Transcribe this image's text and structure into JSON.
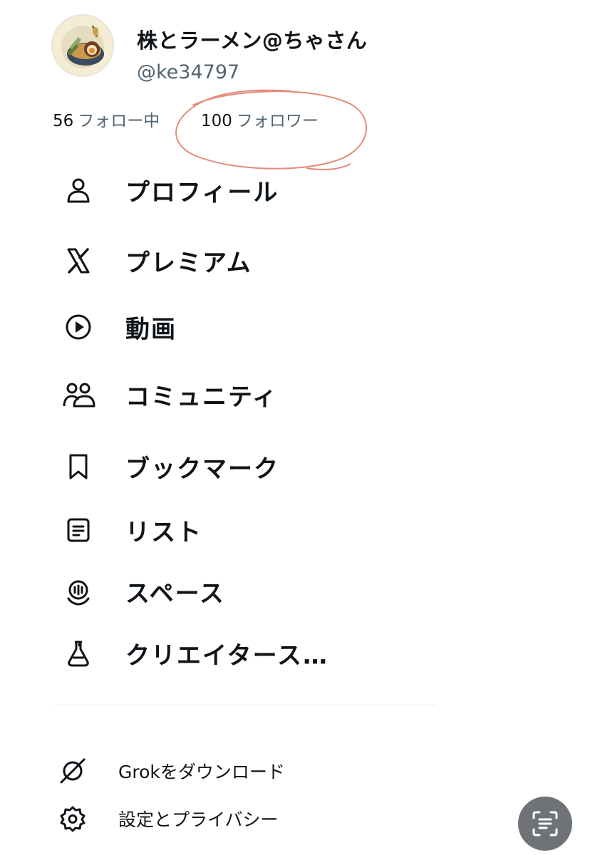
{
  "profile": {
    "display_name": "株とラーメン@ちゃさん",
    "handle": "@ke34797",
    "following_count": "56",
    "following_label": "フォロー中",
    "followers_count": "100",
    "followers_label": "フォロワー"
  },
  "menu": [
    {
      "label": "プロフィール",
      "icon": "person-icon"
    },
    {
      "label": "プレミアム",
      "icon": "x-logo-icon"
    },
    {
      "label": "動画",
      "icon": "play-circle-icon"
    },
    {
      "label": "コミュニティ",
      "icon": "people-icon"
    },
    {
      "label": "ブックマーク",
      "icon": "bookmark-icon"
    },
    {
      "label": "リスト",
      "icon": "list-icon"
    },
    {
      "label": "スペース",
      "icon": "spaces-icon"
    },
    {
      "label": "クリエイタース…",
      "icon": "flask-icon"
    }
  ],
  "secondary": [
    {
      "label": "Grokをダウンロード",
      "icon": "grok-icon"
    },
    {
      "label": "設定とプライバシー",
      "icon": "gear-icon"
    }
  ],
  "colors": {
    "text_primary": "#0f1419",
    "text_secondary": "#536471",
    "annotation_stroke": "#e58b7c",
    "divider": "#e1e6ea",
    "fab_background": "#6f7378"
  }
}
